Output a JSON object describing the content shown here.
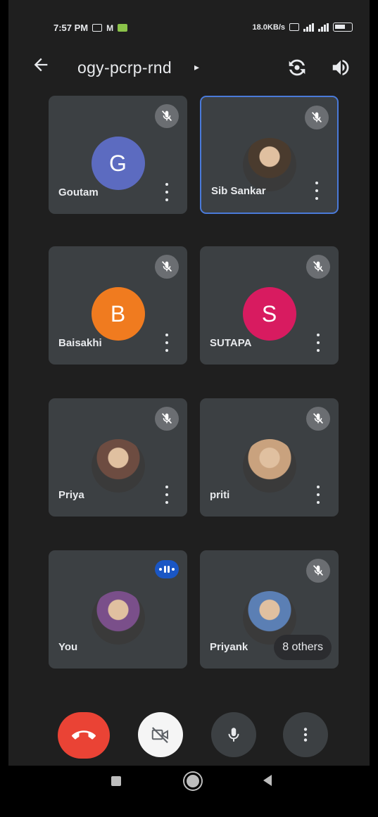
{
  "status_bar": {
    "time": "7:57 PM",
    "network_speed": "18.0KB/s",
    "icons": [
      "message-icon",
      "gmail-icon",
      "gallery-icon",
      "wifi-icon",
      "signal-icon",
      "signal-icon",
      "battery-icon"
    ]
  },
  "header": {
    "meeting_code": "ogy-pcrp-rnd",
    "chevron": "▸"
  },
  "participants": [
    {
      "name": "Goutam",
      "initial": "G",
      "avatar_color": "#5c6bc0",
      "muted": true,
      "photo": false
    },
    {
      "name": "Sib Sankar",
      "initial": "",
      "avatar_color": "#4a3b2e",
      "muted": true,
      "photo": true,
      "active": true
    },
    {
      "name": "Baisakhi",
      "initial": "B",
      "avatar_color": "#f07b1f",
      "muted": true,
      "photo": false
    },
    {
      "name": "SUTAPA",
      "initial": "S",
      "avatar_color": "#d81b60",
      "muted": true,
      "photo": false
    },
    {
      "name": "Priya",
      "initial": "",
      "avatar_color": "#6d4c41",
      "muted": true,
      "photo": true
    },
    {
      "name": "priti",
      "initial": "",
      "avatar_color": "#c9a27e",
      "muted": true,
      "photo": true
    },
    {
      "name": "You",
      "initial": "",
      "avatar_color": "#7a4f8a",
      "muted": false,
      "speaking": true,
      "photo": true
    },
    {
      "name": "Priyank",
      "initial": "",
      "avatar_color": "#5b7fb4",
      "muted": true,
      "photo": true
    }
  ],
  "others_label": "8 others",
  "colors": {
    "end_call": "#ea4335",
    "active_border": "#4a7ad9",
    "speaking_badge": "#1a56c4",
    "tile_bg": "#3c4043"
  }
}
